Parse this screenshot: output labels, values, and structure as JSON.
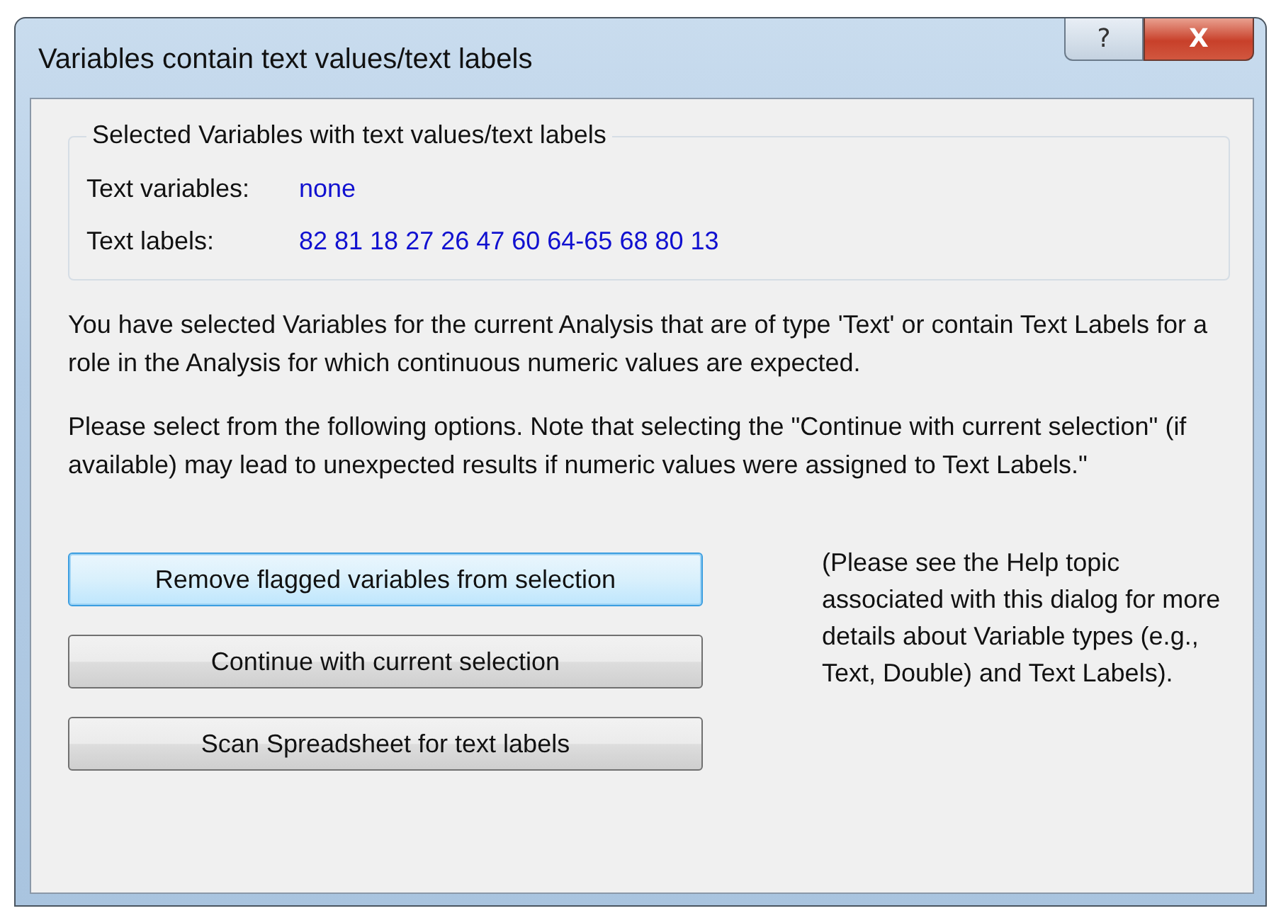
{
  "window": {
    "title": "Variables contain text values/text labels",
    "help_button": "?",
    "close_button": "X"
  },
  "group": {
    "title": "Selected Variables with text values/text labels",
    "rows": [
      {
        "label": "Text variables:",
        "value": "none"
      },
      {
        "label": "Text labels:",
        "value": "82 81 18 27 26 47 60 64-65 68 80 13"
      }
    ]
  },
  "paragraphs": [
    "You have selected Variables for the current Analysis that are of type 'Text' or contain Text Labels for a role in the Analysis for which continuous numeric values are expected.",
    "Please select from the following options. Note that selecting the \"Continue with current selection\" (if available) may lead to unexpected results if numeric values were assigned to Text Labels.\""
  ],
  "buttons": [
    {
      "label": "Remove flagged variables from selection",
      "selected": true
    },
    {
      "label": "Continue with current selection",
      "selected": false
    },
    {
      "label": "Scan Spreadsheet for text labels",
      "selected": false
    }
  ],
  "help_note": "(Please see the Help topic associated with this dialog for more details about Variable types (e.g., Text, Double) and Text Labels)."
}
